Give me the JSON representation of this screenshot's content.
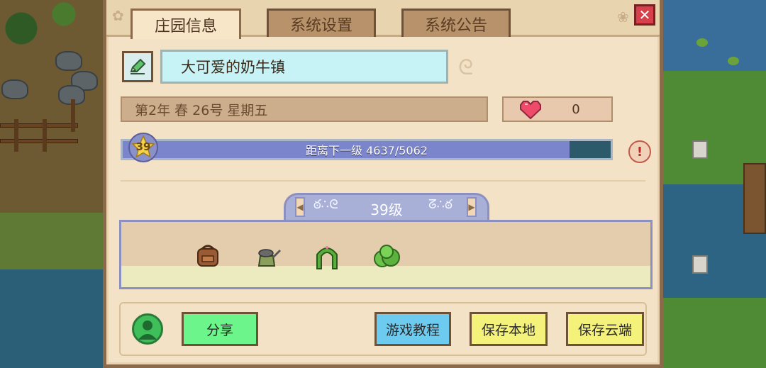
{
  "tabs": [
    {
      "label": "庄园信息",
      "active": true
    },
    {
      "label": "系统设置",
      "active": false
    },
    {
      "label": "系统公告",
      "active": false
    }
  ],
  "close_label": "✕",
  "farm": {
    "name": "大可爱的奶牛镇",
    "date": "第2年  春  26号  星期五",
    "hearts": "0"
  },
  "level": {
    "badge": "39",
    "progress_text": "距离下一级   4637/5062",
    "progress_fraction": 0.916,
    "title": "39级"
  },
  "items": [
    "backpack-icon",
    "watering-can-icon",
    "arch-icon",
    "bush-icon"
  ],
  "buttons": {
    "share": "分享",
    "tutorial": "游戏教程",
    "save_local": "保存本地",
    "save_cloud": "保存云端"
  },
  "colors": {
    "panel": "#f4e2c6",
    "xp_fill": "#7a85cc",
    "green_btn": "#6cf58a",
    "blue_btn": "#6ecbf0",
    "yellow_btn": "#f4f27a",
    "name_box": "#c7f3f6"
  }
}
